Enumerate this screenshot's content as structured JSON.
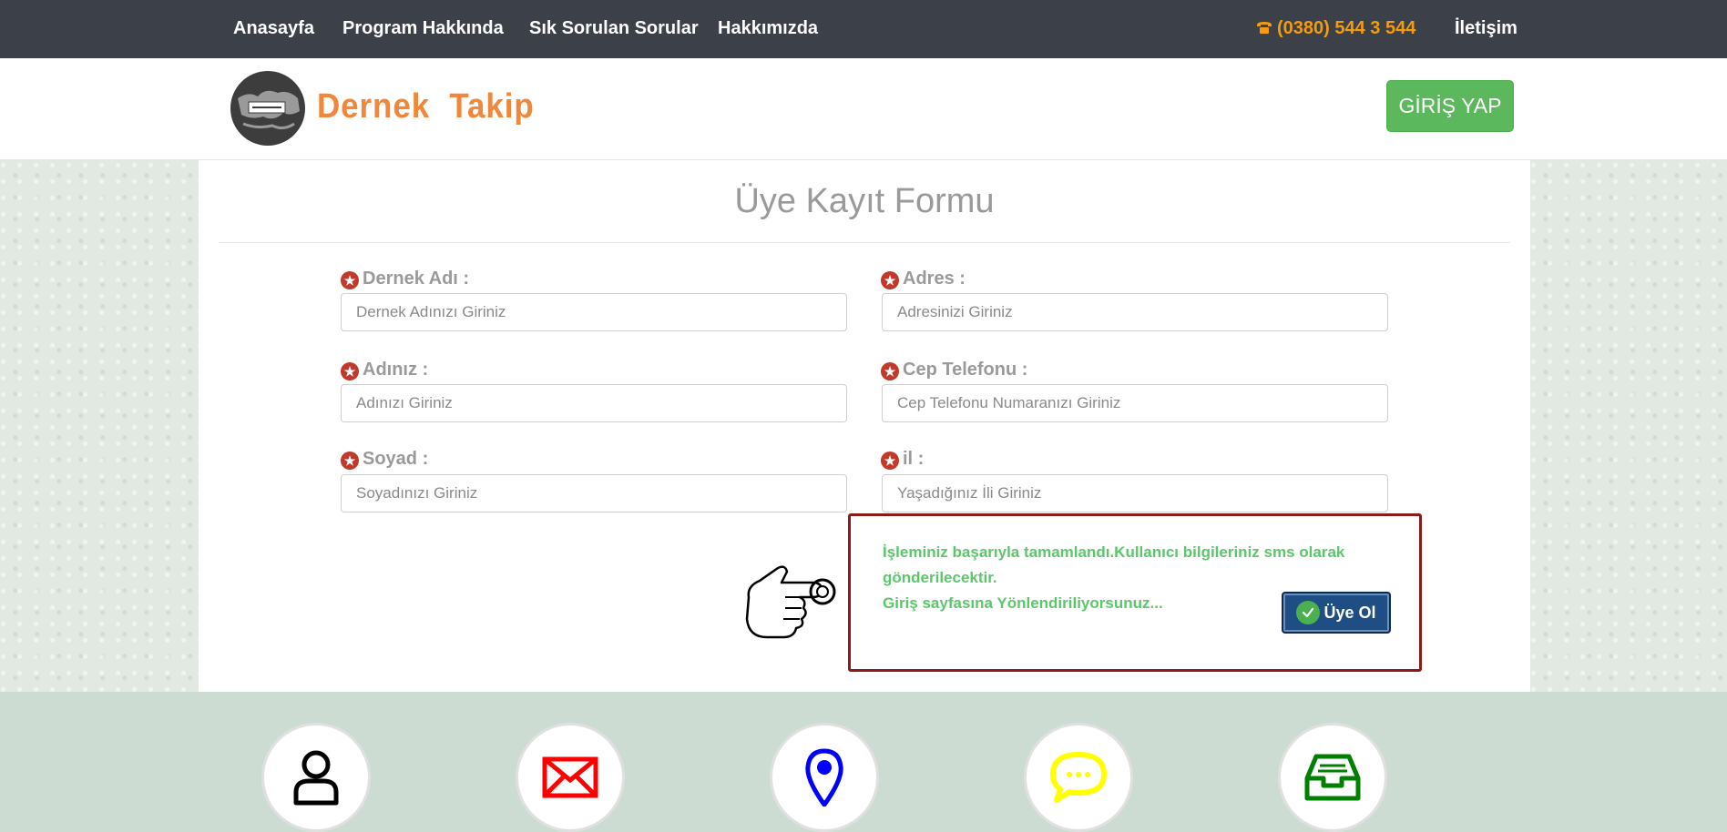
{
  "topnav": {
    "links": [
      "Anasayfa",
      "Program Hakkında",
      "Sık Sorulan Sorular",
      "Hakkımızda"
    ],
    "phone_icon": "phone-icon",
    "phone": "(0380) 544 3 544",
    "contact": "İletişim",
    "phone_color": "#f39c12"
  },
  "header": {
    "logo_text": "Dernek  Takip",
    "login_button": "GİRİŞ YAP"
  },
  "form": {
    "title": "Üye Kayıt Formu",
    "fields": [
      {
        "label": "Dernek Adı :",
        "placeholder": "Dernek Adınızı Giriniz"
      },
      {
        "label": "Adres :",
        "placeholder": "Adresinizi Giriniz"
      },
      {
        "label": "Adınız :",
        "placeholder": "Adınızı Giriniz"
      },
      {
        "label": "Cep Telefonu :",
        "placeholder": "Cep Telefonu Numaranızı Giriniz"
      },
      {
        "label": "Soyad :",
        "placeholder": "Soyadınızı Giriniz"
      },
      {
        "label": "il :",
        "placeholder": "Yaşadığınız İli Giriniz"
      }
    ],
    "required_icon": "star-icon"
  },
  "alert": {
    "line1": "İşleminiz başarıyla tamamlandı.Kullanıcı bilgileriniz sms olarak",
    "line2": "gönderilecektir.",
    "line3": "Giriş sayfasına Yönlendiriliyorsunuz...",
    "button": "Üye Ol",
    "text_color": "#5cc66b",
    "border_color": "#8b1a1a"
  },
  "footer": {
    "icons": [
      {
        "name": "user-icon",
        "color": "#000000"
      },
      {
        "name": "mail-icon",
        "color": "#ff0000"
      },
      {
        "name": "location-icon",
        "color": "#0000ff"
      },
      {
        "name": "chat-icon",
        "color": "#ffff00"
      },
      {
        "name": "inbox-icon",
        "color": "#008000"
      }
    ]
  }
}
